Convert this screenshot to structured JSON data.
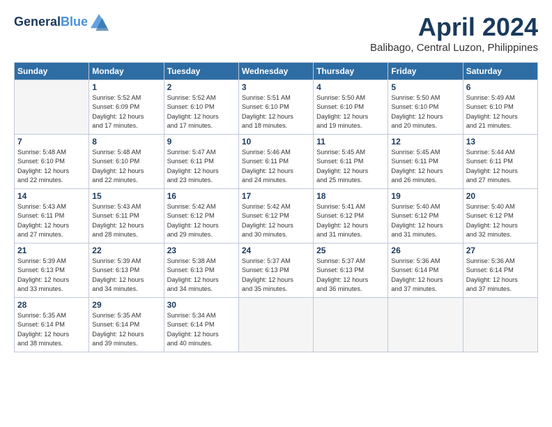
{
  "header": {
    "logo_line1": "General",
    "logo_line2": "Blue",
    "month_title": "April 2024",
    "subtitle": "Balibago, Central Luzon, Philippines"
  },
  "weekdays": [
    "Sunday",
    "Monday",
    "Tuesday",
    "Wednesday",
    "Thursday",
    "Friday",
    "Saturday"
  ],
  "weeks": [
    [
      {
        "day": "",
        "info": ""
      },
      {
        "day": "1",
        "info": "Sunrise: 5:52 AM\nSunset: 6:09 PM\nDaylight: 12 hours\nand 17 minutes."
      },
      {
        "day": "2",
        "info": "Sunrise: 5:52 AM\nSunset: 6:10 PM\nDaylight: 12 hours\nand 17 minutes."
      },
      {
        "day": "3",
        "info": "Sunrise: 5:51 AM\nSunset: 6:10 PM\nDaylight: 12 hours\nand 18 minutes."
      },
      {
        "day": "4",
        "info": "Sunrise: 5:50 AM\nSunset: 6:10 PM\nDaylight: 12 hours\nand 19 minutes."
      },
      {
        "day": "5",
        "info": "Sunrise: 5:50 AM\nSunset: 6:10 PM\nDaylight: 12 hours\nand 20 minutes."
      },
      {
        "day": "6",
        "info": "Sunrise: 5:49 AM\nSunset: 6:10 PM\nDaylight: 12 hours\nand 21 minutes."
      }
    ],
    [
      {
        "day": "7",
        "info": "Sunrise: 5:48 AM\nSunset: 6:10 PM\nDaylight: 12 hours\nand 22 minutes."
      },
      {
        "day": "8",
        "info": "Sunrise: 5:48 AM\nSunset: 6:10 PM\nDaylight: 12 hours\nand 22 minutes."
      },
      {
        "day": "9",
        "info": "Sunrise: 5:47 AM\nSunset: 6:11 PM\nDaylight: 12 hours\nand 23 minutes."
      },
      {
        "day": "10",
        "info": "Sunrise: 5:46 AM\nSunset: 6:11 PM\nDaylight: 12 hours\nand 24 minutes."
      },
      {
        "day": "11",
        "info": "Sunrise: 5:45 AM\nSunset: 6:11 PM\nDaylight: 12 hours\nand 25 minutes."
      },
      {
        "day": "12",
        "info": "Sunrise: 5:45 AM\nSunset: 6:11 PM\nDaylight: 12 hours\nand 26 minutes."
      },
      {
        "day": "13",
        "info": "Sunrise: 5:44 AM\nSunset: 6:11 PM\nDaylight: 12 hours\nand 27 minutes."
      }
    ],
    [
      {
        "day": "14",
        "info": "Sunrise: 5:43 AM\nSunset: 6:11 PM\nDaylight: 12 hours\nand 27 minutes."
      },
      {
        "day": "15",
        "info": "Sunrise: 5:43 AM\nSunset: 6:11 PM\nDaylight: 12 hours\nand 28 minutes."
      },
      {
        "day": "16",
        "info": "Sunrise: 5:42 AM\nSunset: 6:12 PM\nDaylight: 12 hours\nand 29 minutes."
      },
      {
        "day": "17",
        "info": "Sunrise: 5:42 AM\nSunset: 6:12 PM\nDaylight: 12 hours\nand 30 minutes."
      },
      {
        "day": "18",
        "info": "Sunrise: 5:41 AM\nSunset: 6:12 PM\nDaylight: 12 hours\nand 31 minutes."
      },
      {
        "day": "19",
        "info": "Sunrise: 5:40 AM\nSunset: 6:12 PM\nDaylight: 12 hours\nand 31 minutes."
      },
      {
        "day": "20",
        "info": "Sunrise: 5:40 AM\nSunset: 6:12 PM\nDaylight: 12 hours\nand 32 minutes."
      }
    ],
    [
      {
        "day": "21",
        "info": "Sunrise: 5:39 AM\nSunset: 6:13 PM\nDaylight: 12 hours\nand 33 minutes."
      },
      {
        "day": "22",
        "info": "Sunrise: 5:39 AM\nSunset: 6:13 PM\nDaylight: 12 hours\nand 34 minutes."
      },
      {
        "day": "23",
        "info": "Sunrise: 5:38 AM\nSunset: 6:13 PM\nDaylight: 12 hours\nand 34 minutes."
      },
      {
        "day": "24",
        "info": "Sunrise: 5:37 AM\nSunset: 6:13 PM\nDaylight: 12 hours\nand 35 minutes."
      },
      {
        "day": "25",
        "info": "Sunrise: 5:37 AM\nSunset: 6:13 PM\nDaylight: 12 hours\nand 36 minutes."
      },
      {
        "day": "26",
        "info": "Sunrise: 5:36 AM\nSunset: 6:14 PM\nDaylight: 12 hours\nand 37 minutes."
      },
      {
        "day": "27",
        "info": "Sunrise: 5:36 AM\nSunset: 6:14 PM\nDaylight: 12 hours\nand 37 minutes."
      }
    ],
    [
      {
        "day": "28",
        "info": "Sunrise: 5:35 AM\nSunset: 6:14 PM\nDaylight: 12 hours\nand 38 minutes."
      },
      {
        "day": "29",
        "info": "Sunrise: 5:35 AM\nSunset: 6:14 PM\nDaylight: 12 hours\nand 39 minutes."
      },
      {
        "day": "30",
        "info": "Sunrise: 5:34 AM\nSunset: 6:14 PM\nDaylight: 12 hours\nand 40 minutes."
      },
      {
        "day": "",
        "info": ""
      },
      {
        "day": "",
        "info": ""
      },
      {
        "day": "",
        "info": ""
      },
      {
        "day": "",
        "info": ""
      }
    ]
  ]
}
